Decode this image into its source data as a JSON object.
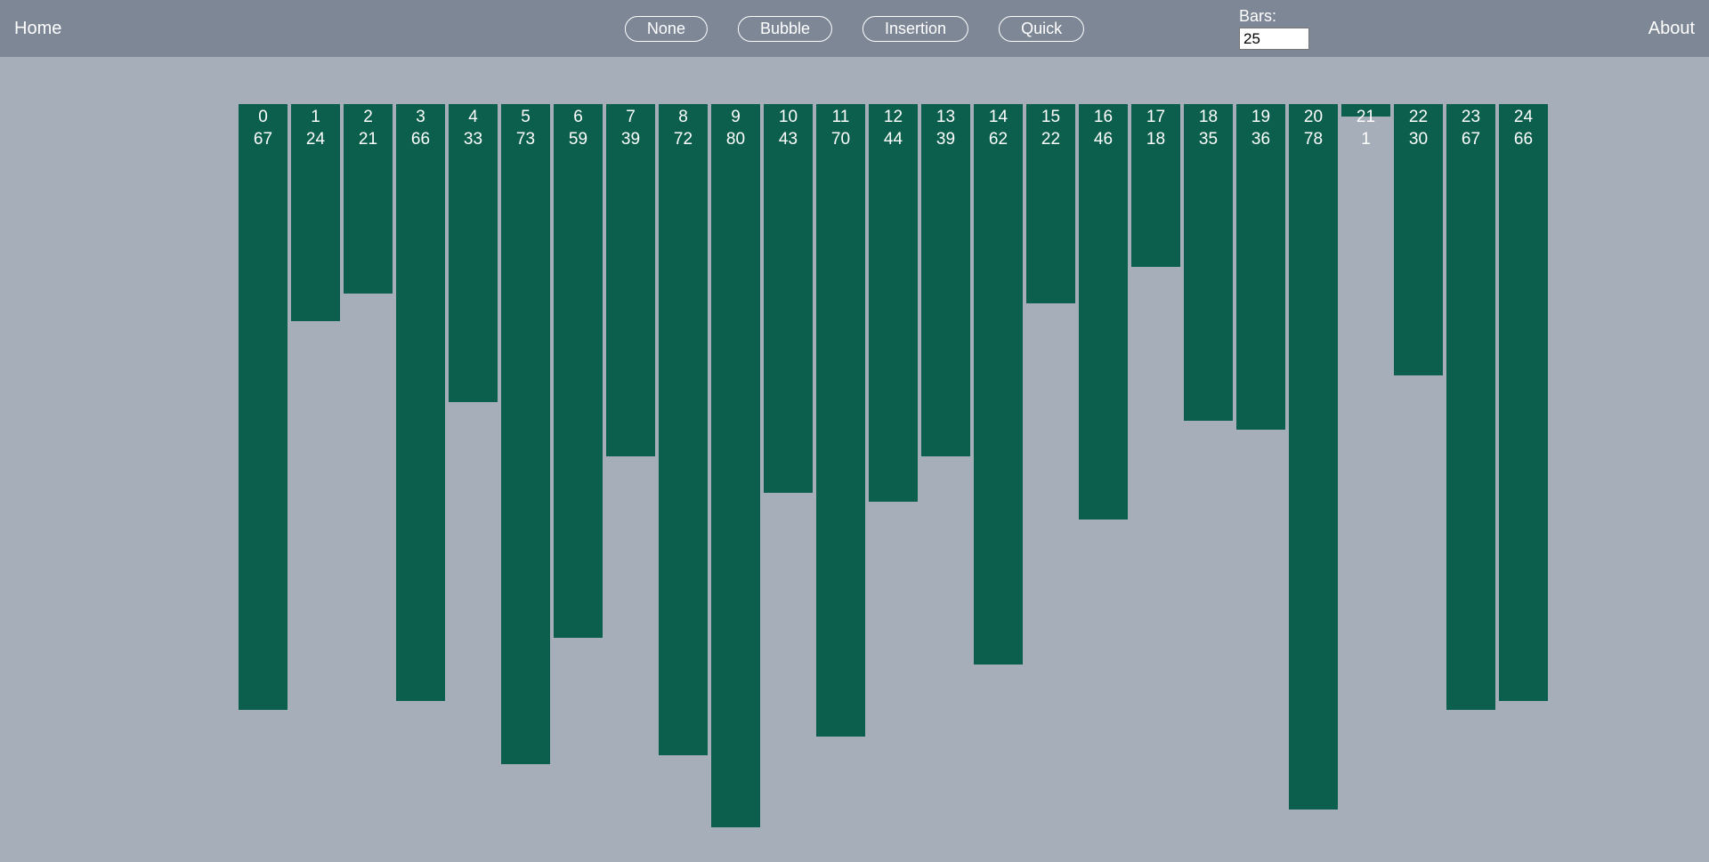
{
  "nav": {
    "home": "Home",
    "about": "About",
    "bars_label": "Bars:",
    "bars_value": "25"
  },
  "buttons": {
    "none": "None",
    "bubble": "Bubble",
    "insertion": "Insertion",
    "quick": "Quick"
  },
  "chart_data": {
    "type": "bar",
    "title": "",
    "xlabel": "",
    "ylabel": "",
    "ylim": [
      0,
      100
    ],
    "categories": [
      0,
      1,
      2,
      3,
      4,
      5,
      6,
      7,
      8,
      9,
      10,
      11,
      12,
      13,
      14,
      15,
      16,
      17,
      18,
      19,
      20,
      21,
      22,
      23,
      24
    ],
    "values": [
      67,
      24,
      21,
      66,
      33,
      73,
      59,
      39,
      72,
      80,
      43,
      70,
      44,
      39,
      62,
      22,
      46,
      18,
      35,
      36,
      78,
      1,
      30,
      67,
      66
    ]
  },
  "colors": {
    "bar": "#0c5f4c",
    "header": "#7d8796",
    "background": "#a6aeb9",
    "text_light": "#ffffff"
  }
}
